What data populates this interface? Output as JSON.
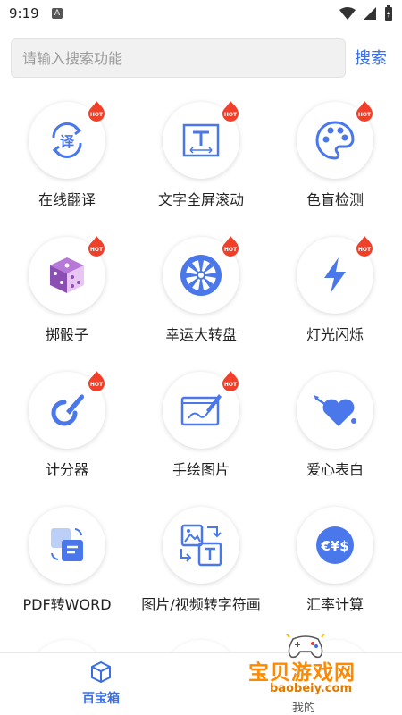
{
  "status_bar": {
    "time": "9:19",
    "app_badge": "A"
  },
  "search": {
    "placeholder": "请输入搜索功能",
    "button_label": "搜索"
  },
  "colors": {
    "accent": "#3a6ee8",
    "hot": "#f0402a",
    "icon_blue": "#4a78ea",
    "watermark": "#ff8a00"
  },
  "grid": [
    [
      {
        "label": "在线翻译",
        "icon": "translate-icon",
        "hot": true
      },
      {
        "label": "文字全屏滚动",
        "icon": "text-scroll-icon",
        "hot": true
      },
      {
        "label": "色盲检测",
        "icon": "palette-icon",
        "hot": true
      }
    ],
    [
      {
        "label": "掷骰子",
        "icon": "dice-icon",
        "hot": true
      },
      {
        "label": "幸运大转盘",
        "icon": "wheel-icon",
        "hot": true
      },
      {
        "label": "灯光闪烁",
        "icon": "lightning-icon",
        "hot": true
      }
    ],
    [
      {
        "label": "计分器",
        "icon": "counter-icon",
        "hot": true
      },
      {
        "label": "手绘图片",
        "icon": "draw-icon",
        "hot": true
      },
      {
        "label": "爱心表白",
        "icon": "heart-arrow-icon",
        "hot": false
      }
    ],
    [
      {
        "label": "PDF转WORD",
        "icon": "pdf-convert-icon",
        "hot": false
      },
      {
        "label": "图片/视频转字符画",
        "icon": "image-to-text-icon",
        "hot": false
      },
      {
        "label": "汇率计算",
        "icon": "currency-icon",
        "hot": false
      }
    ]
  ],
  "hot_badge_text": "HOT",
  "bottom_nav": {
    "home_label": "百宝箱",
    "mine_label": "我的"
  },
  "watermark": {
    "title": "宝贝游戏网",
    "url": "baobeiy.com"
  }
}
